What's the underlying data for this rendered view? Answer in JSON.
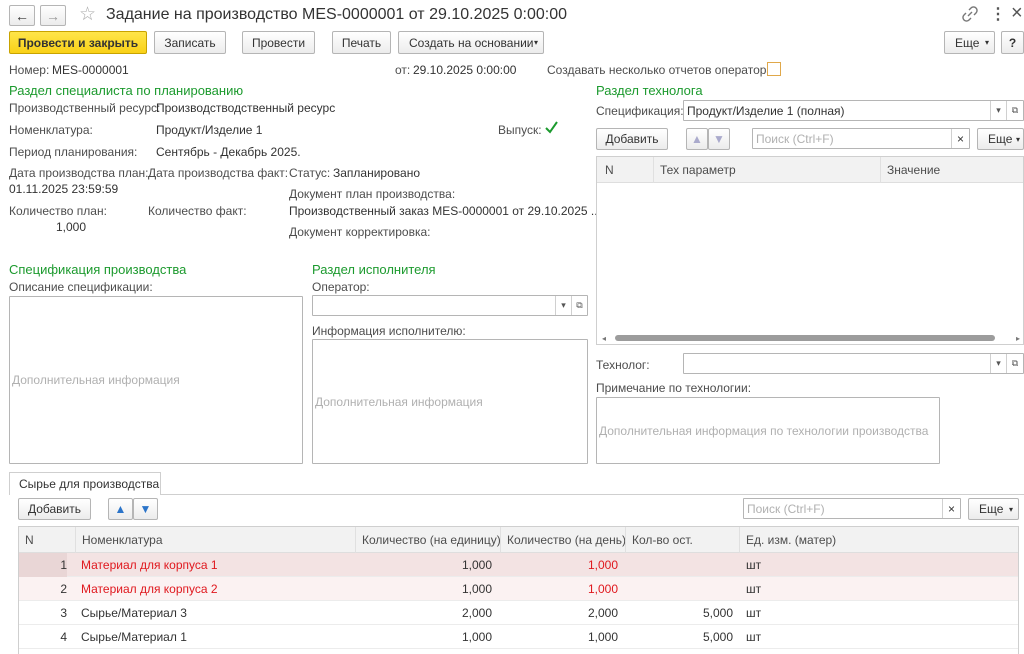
{
  "window": {
    "title": "Задание на производство MES-0000001 от 29.10.2025 0:00:00",
    "nav_back": "←",
    "nav_forward": "→",
    "star": "☆",
    "link": "🔗",
    "more": "⋮",
    "close": "×"
  },
  "toolbar": {
    "post_close": "Провести и закрыть",
    "save": "Записать",
    "post": "Провести",
    "print": "Печать",
    "create_based": "Создать на основании",
    "more": "Еще",
    "help": "?"
  },
  "header": {
    "number_label": "Номер:",
    "number_value": "MES-0000001",
    "date_label": "от:",
    "date_value": "29.10.2025 0:00:00",
    "multi_reports_label": "Создавать несколько отчетов оператора:"
  },
  "planning": {
    "title": "Раздел специалиста по планированию",
    "resource_label": "Производственный ресурс:",
    "resource_value": "Производстводственный ресурс",
    "nomenclature_label": "Номенклатура:",
    "nomenclature_value": "Продукт/Изделие 1",
    "output_label": "Выпуск:",
    "period_label": "Период планирования:",
    "period_value": "Сентябрь - Декабрь 2025.",
    "plan_date_label": "Дата производства план:",
    "plan_date_value": "01.11.2025 23:59:59",
    "fact_date_label": "Дата производства факт:",
    "status_label": "Статус:",
    "status_value": "Запланировано",
    "plan_doc_label": "Документ план производства:",
    "plan_doc_value": "Производственный заказ MES-0000001 от 29.10.2025 ...",
    "qty_plan_label": "Количество план:",
    "qty_plan_value": "1,000",
    "qty_fact_label": "Количество факт:",
    "correction_doc_label": "Документ корректировка:"
  },
  "spec": {
    "title": "Спецификация производства",
    "desc_label": "Описание спецификации:",
    "desc_placeholder": "Дополнительная информация"
  },
  "executor": {
    "title": "Раздел исполнителя",
    "operator_label": "Оператор:",
    "info_label": "Информация исполнителю:",
    "info_placeholder": "Дополнительная информация"
  },
  "technologist": {
    "title": "Раздел технолога",
    "spec_label": "Спецификация:",
    "spec_value": "Продукт/Изделие 1 (полная)",
    "add": "Добавить",
    "search_placeholder": "Поиск (Ctrl+F)",
    "more": "Еще",
    "col_n": "N",
    "col_param": "Тех параметр",
    "col_value": "Значение",
    "tech_label": "Технолог:",
    "note_label": "Примечание по технологии:",
    "note_placeholder": "Дополнительная информация по технологии производства"
  },
  "materials": {
    "tab": "Сырье для производства",
    "add": "Добавить",
    "search_placeholder": "Поиск (Ctrl+F)",
    "more": "Еще",
    "columns": [
      "N",
      "Номенклатура",
      "Количество (на единицу)",
      "Количество (на день)",
      "Кол-во ост.",
      "Ед. изм. (матер)"
    ],
    "rows": [
      {
        "n": "1",
        "name": "Материал для корпуса 1",
        "per_unit": "1,000",
        "per_day": "1,000",
        "rest": "",
        "unit": "шт"
      },
      {
        "n": "2",
        "name": "Материал для корпуса 2",
        "per_unit": "1,000",
        "per_day": "1,000",
        "rest": "",
        "unit": "шт"
      },
      {
        "n": "3",
        "name": "Сырье/Материал 3",
        "per_unit": "2,000",
        "per_day": "2,000",
        "rest": "5,000",
        "unit": "шт"
      },
      {
        "n": "4",
        "name": "Сырье/Материал 1",
        "per_unit": "1,000",
        "per_day": "1,000",
        "rest": "5,000",
        "unit": "шт"
      }
    ]
  },
  "colors": {
    "section_title": "#1c9a2e",
    "primary_button": "#f9d117",
    "error_text": "#e0181e",
    "selected_row": "#f3e3e3"
  }
}
